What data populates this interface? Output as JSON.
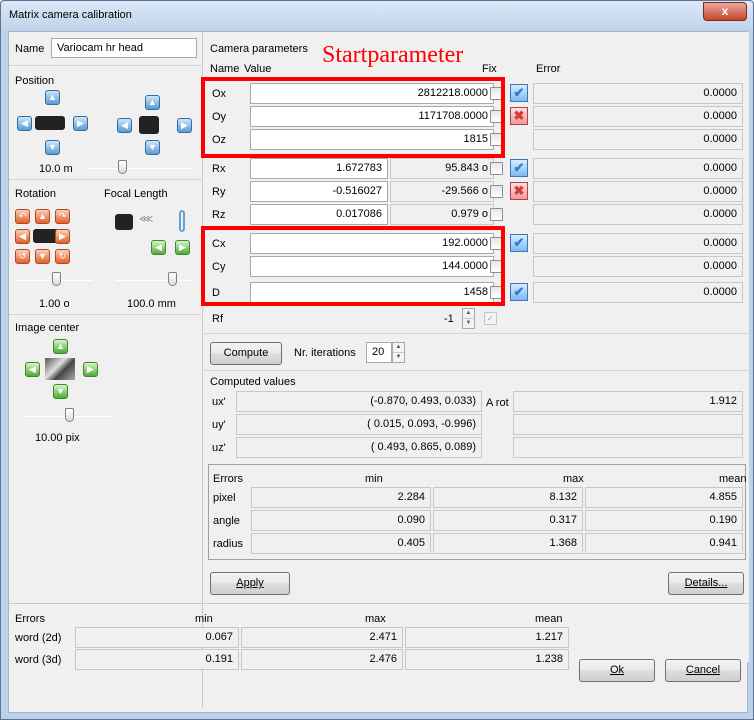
{
  "window": {
    "title": "Matrix camera calibration",
    "close_glyph": "x"
  },
  "left": {
    "name_label": "Name",
    "name_value": "Variocam hr head",
    "position_label": "Position",
    "position_distance": "10.0  m",
    "rotation_label": "Rotation",
    "focal_length_label": "Focal Length",
    "rotation_value": "1.00  o",
    "focal_value": "100.0  mm",
    "image_center_label": "Image center",
    "image_center_value": "10.00  pix"
  },
  "params": {
    "section_label": "Camera parameters",
    "annotation": "Startparameter",
    "col_name": "Name",
    "col_value": "Value",
    "col_fix": "Fix",
    "col_error": "Error",
    "rows": [
      {
        "name": "Ox",
        "value": "2812218.0000",
        "deg": "",
        "checked": false,
        "icon": "blue-check-icon",
        "error": "0.0000"
      },
      {
        "name": "Oy",
        "value": "1171708.0000",
        "deg": "",
        "checked": false,
        "icon": "red-x-icon",
        "error": "0.0000"
      },
      {
        "name": "Oz",
        "value": "1815",
        "deg": "",
        "checked": false,
        "icon": "",
        "error": "0.0000"
      },
      {
        "name": "Rx",
        "value": "1.672783",
        "deg": "95.843 o",
        "checked": false,
        "icon": "blue-check-icon",
        "error": "0.0000"
      },
      {
        "name": "Ry",
        "value": "-0.516027",
        "deg": "-29.566 o",
        "checked": false,
        "icon": "red-x-icon",
        "error": "0.0000"
      },
      {
        "name": "Rz",
        "value": "0.017086",
        "deg": "0.979 o",
        "checked": false,
        "icon": "",
        "error": "0.0000"
      },
      {
        "name": "Cx",
        "value": "192.0000",
        "deg": "",
        "checked": false,
        "icon": "blue-check-icon",
        "error": "0.0000"
      },
      {
        "name": "Cy",
        "value": "144.0000",
        "deg": "",
        "checked": false,
        "icon": "",
        "error": "0.0000"
      },
      {
        "name": "D",
        "value": "1458",
        "deg": "",
        "checked": false,
        "icon": "blue-check-icon",
        "error": "0.0000"
      }
    ],
    "rf_label": "Rf",
    "rf_value": "-1"
  },
  "compute": {
    "button": "Compute",
    "iterations_label": "Nr. iterations",
    "iterations_value": "20"
  },
  "computed": {
    "label": "Computed values",
    "rows": [
      {
        "name": "ux'",
        "value": "(-0.870,  0.493,  0.033)"
      },
      {
        "name": "uy'",
        "value": "( 0.015,  0.093, -0.996)"
      },
      {
        "name": "uz'",
        "value": "( 0.493,  0.865,  0.089)"
      }
    ],
    "arot_label": "A rot",
    "arot_value": "1.912"
  },
  "errors": {
    "header": "Errors",
    "cols": [
      "min",
      "max",
      "mean"
    ],
    "rows": [
      {
        "name": "pixel",
        "min": "2.284",
        "max": "8.132",
        "mean": "4.855"
      },
      {
        "name": "angle",
        "min": "0.090",
        "max": "0.317",
        "mean": "0.190"
      },
      {
        "name": "radius",
        "min": "0.405",
        "max": "1.368",
        "mean": "0.941"
      }
    ]
  },
  "buttons": {
    "apply": "Apply",
    "details": "Details...",
    "ok": "Ok",
    "cancel": "Cancel"
  },
  "world_errors": {
    "header": "Errors",
    "cols": [
      "min",
      "max",
      "mean"
    ],
    "rows": [
      {
        "name": "word (2d)",
        "min": "0.067",
        "max": "2.471",
        "mean": "1.217"
      },
      {
        "name": "word (3d)",
        "min": "0.191",
        "max": "2.476",
        "mean": "1.238"
      }
    ]
  },
  "colors": {
    "annotation_red": "#ff0000",
    "check_blue": "#2a7ed8",
    "x_red": "#d63a3a"
  }
}
